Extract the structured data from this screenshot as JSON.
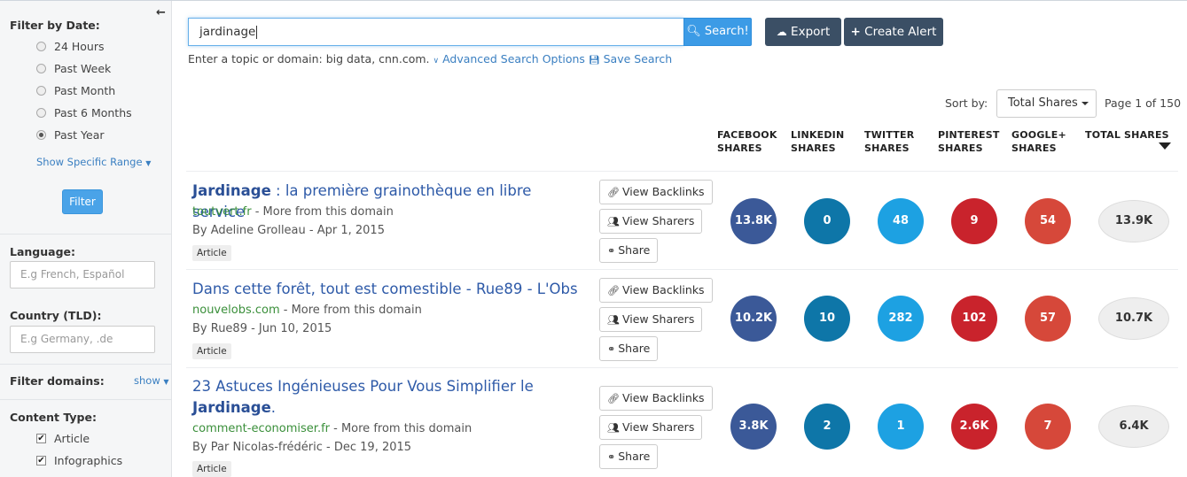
{
  "sidebar": {
    "filter_by_date_title": "Filter by Date:",
    "date_options": [
      {
        "label": "24 Hours",
        "checked": false
      },
      {
        "label": "Past Week",
        "checked": false
      },
      {
        "label": "Past Month",
        "checked": false
      },
      {
        "label": "Past 6 Months",
        "checked": false
      },
      {
        "label": "Past Year",
        "checked": true
      }
    ],
    "show_specific_range": "Show Specific Range",
    "filter_button": "Filter",
    "language_title": "Language:",
    "language_placeholder": "E.g French, Español",
    "country_title": "Country (TLD):",
    "country_placeholder": "E.g Germany, .de",
    "filter_domains_title": "Filter domains:",
    "filter_domains_show": "show",
    "content_type_title": "Content Type:",
    "content_types": [
      {
        "label": "Article",
        "checked": true
      },
      {
        "label": "Infographics",
        "checked": true
      }
    ]
  },
  "search": {
    "value": "jardinage",
    "search_button": "Search!",
    "export_button": "Export",
    "create_alert_button": "Create Alert",
    "hint": "Enter a topic or domain: big data, cnn.com.",
    "advanced_link": "Advanced Search Options",
    "save_link": "Save Search"
  },
  "sort": {
    "label": "Sort by:",
    "selected": "Total Shares",
    "page_info": "Page 1 of 150"
  },
  "columns": [
    {
      "line1": "FACEBOOK",
      "line2": "SHARES"
    },
    {
      "line1": "LINKEDIN",
      "line2": "SHARES"
    },
    {
      "line1": "TWITTER",
      "line2": "SHARES"
    },
    {
      "line1": "PINTEREST",
      "line2": "SHARES"
    },
    {
      "line1": "GOOGLE+",
      "line2": "SHARES"
    },
    {
      "line1": "TOTAL SHARES",
      "line2": ""
    }
  ],
  "actions": {
    "view_backlinks": "View Backlinks",
    "view_sharers": "View Sharers",
    "share": "Share"
  },
  "colors": {
    "facebook": "#3b5998",
    "linkedin": "#0e76a8",
    "twitter": "#1da1e2",
    "pinterest": "#c9232c",
    "googleplus": "#d6483a"
  },
  "results": [
    {
      "title_bold": "Jardinage",
      "title_rest": " : la première grainothèque en libre service",
      "domain": "toutvert.fr",
      "more": " - More from this domain",
      "byline": "By Adeline Grolleau - Apr 1, 2015",
      "type": "Article",
      "facebook": "13.8K",
      "linkedin": "0",
      "twitter": "48",
      "pinterest": "9",
      "googleplus": "54",
      "total": "13.9K"
    },
    {
      "title_plain": "Dans cette forêt, tout est comestible - Rue89 - L'Obs",
      "domain": "nouvelobs.com",
      "more": " - More from this domain",
      "byline": "By Rue89 - Jun 10, 2015",
      "type": "Article",
      "facebook": "10.2K",
      "linkedin": "10",
      "twitter": "282",
      "pinterest": "102",
      "googleplus": "57",
      "total": "10.7K"
    },
    {
      "title_line1": "23 Astuces Ingénieuses Pour Vous Simplifier le",
      "title_bold": "Jardinage",
      "title_end": ".",
      "domain": "comment-economiser.fr",
      "more": " - More from this domain",
      "byline": "By Par Nicolas-frédéric - Dec 19, 2015",
      "type": "Article",
      "facebook": "3.8K",
      "linkedin": "2",
      "twitter": "1",
      "pinterest": "2.6K",
      "googleplus": "7",
      "total": "6.4K"
    }
  ]
}
